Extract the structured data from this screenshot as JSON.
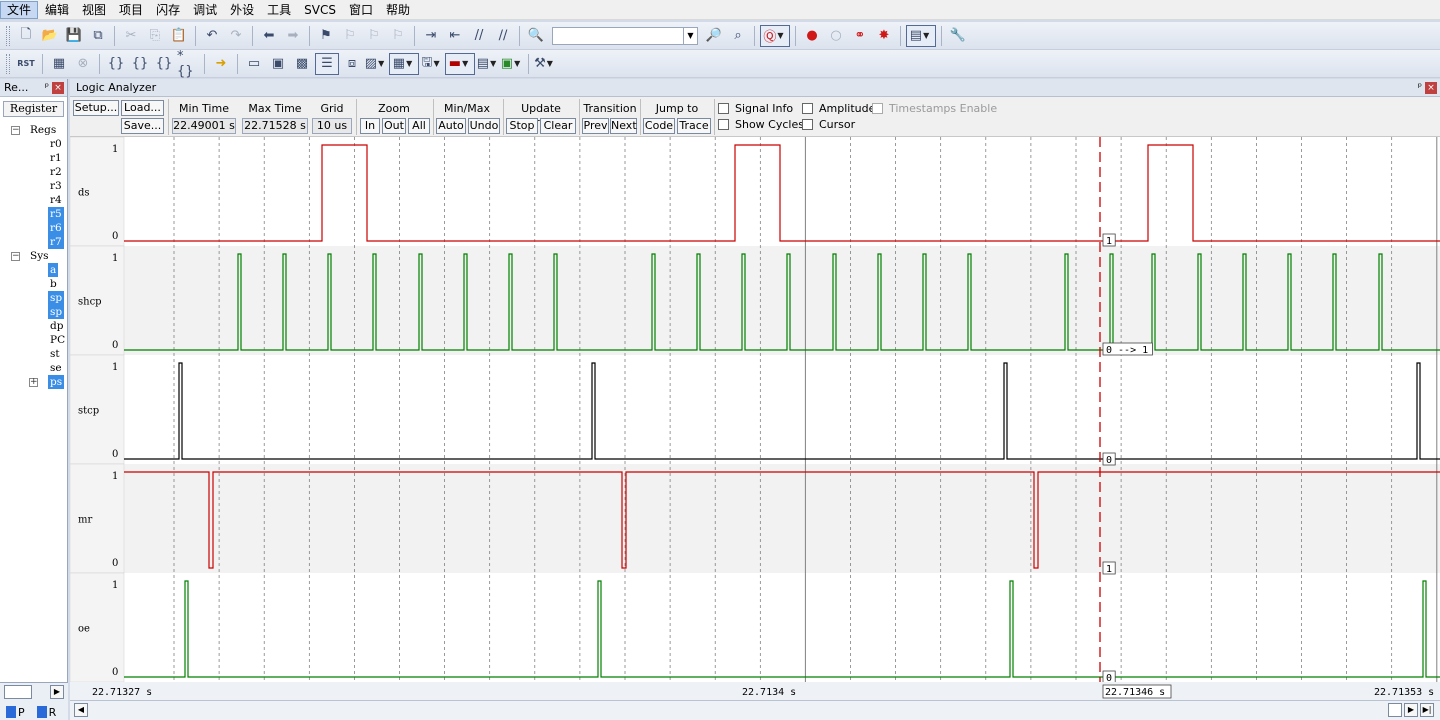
{
  "menu": [
    "文件",
    "编辑",
    "视图",
    "项目",
    "闪存",
    "调试",
    "外设",
    "工具",
    "SVCS",
    "窗口",
    "帮助"
  ],
  "toolbar1": {
    "target_combo_value": "",
    "icons": [
      "new-file-icon",
      "open-folder-icon",
      "save-icon",
      "save-all-icon",
      "cut-icon",
      "copy-icon",
      "paste-icon",
      "undo-icon",
      "redo-icon",
      "nav-back-icon",
      "nav-forward-icon",
      "bookmark-icon",
      "bookmark-prev-icon",
      "bookmark-next-icon",
      "bookmark-clear-icon",
      "indent-icon",
      "unindent-icon",
      "comment-icon",
      "uncomment-icon",
      "find-in-files-icon"
    ]
  },
  "register_panel": {
    "title": "Re...",
    "pin": "ᵖ",
    "close": "×",
    "header": "Register",
    "groups": [
      {
        "name": "Regs",
        "items": [
          {
            "label": "r0",
            "selected": false
          },
          {
            "label": "r1",
            "selected": false
          },
          {
            "label": "r2",
            "selected": false
          },
          {
            "label": "r3",
            "selected": false
          },
          {
            "label": "r4",
            "selected": false
          },
          {
            "label": "r5",
            "selected": true
          },
          {
            "label": "r6",
            "selected": true
          },
          {
            "label": "r7",
            "selected": true
          }
        ]
      },
      {
        "name": "Sys",
        "items": [
          {
            "label": "a",
            "selected": true
          },
          {
            "label": "b",
            "selected": false
          },
          {
            "label": "sp",
            "selected": true
          },
          {
            "label": "sp",
            "selected": true
          },
          {
            "label": "dp",
            "selected": false
          },
          {
            "label": "PC",
            "selected": false
          },
          {
            "label": "st",
            "selected": false
          },
          {
            "label": "se",
            "selected": false
          },
          {
            "label": "ps",
            "selected": true
          }
        ]
      }
    ],
    "bottom_tabs": [
      "P",
      "R"
    ]
  },
  "logic_analyzer": {
    "title": "Logic Analyzer",
    "buttons": {
      "setup": "Setup...",
      "load": "Load...",
      "save": "Save...",
      "zoom_in": "In",
      "zoom_out": "Out",
      "zoom_all": "All",
      "minmax_auto": "Auto",
      "minmax_undo": "Undo",
      "update_stop": "Stop",
      "update_clear": "Clear",
      "transition_prev": "Prev",
      "transition_next": "Next",
      "jump_code": "Code",
      "jump_trace": "Trace"
    },
    "labels": {
      "min_time": "Min Time",
      "max_time": "Max Time",
      "grid": "Grid",
      "zoom": "Zoom",
      "minmax": "Min/Max",
      "update_screen": "Update Screen",
      "transition": "Transition",
      "jump_to": "Jump to"
    },
    "values": {
      "min_time": "22.49001 s",
      "max_time": "22.71528 s",
      "grid": "10 us"
    },
    "checkboxes": {
      "signal_info": "Signal Info",
      "show_cycles": "Show Cycles",
      "amplitude": "Amplitude",
      "cursor": "Cursor",
      "timestamps_enable": "Timestamps Enable"
    },
    "time_axis": {
      "start_label": "22.71327 s",
      "mid_label": "22.7134 s",
      "cursor_label": "22.71346 s",
      "end_label": "22.71353 s"
    },
    "signals": [
      {
        "name": "ds",
        "high_label": "1",
        "low_label": "0",
        "color": "#cc0000",
        "cursor_value": "1",
        "segments": [
          [
            0,
            0
          ],
          [
            198,
            1
          ],
          [
            243,
            0
          ],
          [
            611,
            1
          ],
          [
            656,
            0
          ],
          [
            1024,
            1
          ],
          [
            1069,
            0
          ],
          [
            1370,
            0
          ]
        ]
      },
      {
        "name": "shcp",
        "high_label": "1",
        "low_label": "0",
        "color": "#008000",
        "cursor_value": "0 --> 1",
        "pulses": [
          114,
          159,
          204,
          249,
          295,
          340,
          385,
          430,
          528,
          573,
          618,
          663,
          709,
          754,
          799,
          844,
          941,
          986,
          1028,
          1074,
          1119,
          1164,
          1209,
          1255,
          1352
        ]
      },
      {
        "name": "stcp",
        "high_label": "1",
        "low_label": "0",
        "color": "#000000",
        "cursor_value": "0",
        "pulses": [
          55,
          468,
          880,
          1293
        ]
      },
      {
        "name": "mr",
        "high_label": "1",
        "low_label": "0",
        "color": "#cc0000",
        "cursor_value": "1",
        "dips": [
          85,
          498,
          910,
          1323
        ]
      },
      {
        "name": "oe",
        "high_label": "1",
        "low_label": "0",
        "color": "#008000",
        "cursor_value": "0",
        "pulses": [
          61,
          474,
          886,
          1299
        ]
      }
    ],
    "cursor_color": "#cc0000"
  }
}
